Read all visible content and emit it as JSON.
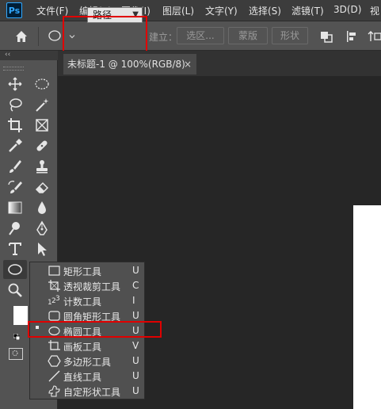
{
  "app": {
    "logo": "Ps"
  },
  "menu": [
    "文件(F)",
    "编辑(E)",
    "图像(I)",
    "图层(L)",
    "文字(Y)",
    "选择(S)",
    "滤镜(T)",
    "3D(D)",
    "视"
  ],
  "options": {
    "home_icon": "home-icon",
    "tool_icon": "ellipse-icon",
    "mode_value": "路径",
    "make_label": "建立：",
    "selection_button": "选区...",
    "mask_button": "蒙版",
    "shape_button": "形状"
  },
  "document": {
    "tab_title": "未标题-1 @ 100%(RGB/8)",
    "close": "×"
  },
  "tools_panel": {
    "collapse": "‹‹"
  },
  "flyout": [
    {
      "icon": "rectangle-icon",
      "label": "矩形工具",
      "key": "U"
    },
    {
      "icon": "perspective-crop-icon",
      "label": "透视裁剪工具",
      "key": "C"
    },
    {
      "icon": "count-icon",
      "label": "计数工具",
      "key": "I"
    },
    {
      "icon": "rounded-rectangle-icon",
      "label": "圆角矩形工具",
      "key": "U"
    },
    {
      "icon": "ellipse-icon",
      "label": "椭圆工具",
      "key": "U",
      "selected": true
    },
    {
      "icon": "artboard-icon",
      "label": "画板工具",
      "key": "V"
    },
    {
      "icon": "polygon-icon",
      "label": "多边形工具",
      "key": "U"
    },
    {
      "icon": "line-icon",
      "label": "直线工具",
      "key": "U"
    },
    {
      "icon": "custom-shape-icon",
      "label": "自定形状工具",
      "key": "U"
    }
  ],
  "colors": {
    "highlight": "#e00000",
    "canvas": "#ffffff",
    "panel": "#535353",
    "workspace": "#262626"
  }
}
